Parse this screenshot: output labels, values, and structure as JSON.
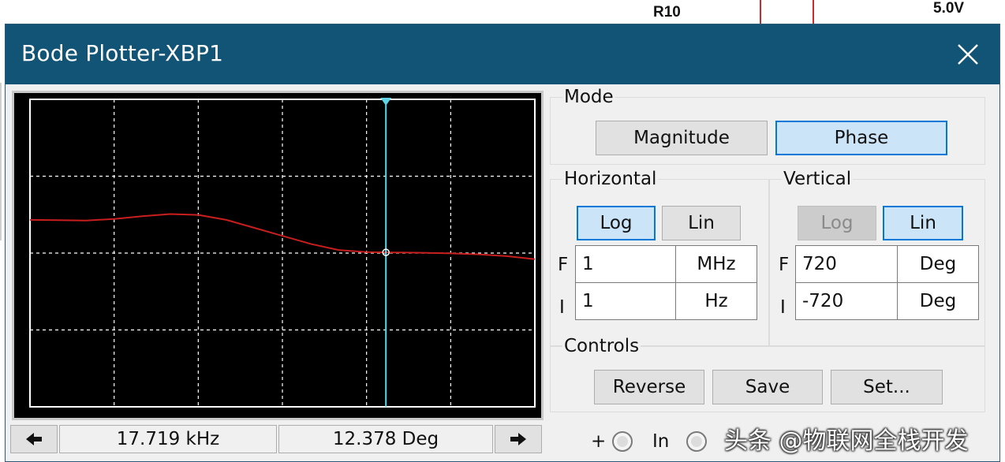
{
  "background": {
    "component_label": "R10",
    "voltage_label": "5.0V"
  },
  "window": {
    "title": "Bode Plotter-XBP1",
    "close_icon": "close-icon"
  },
  "plot": {
    "background": "#000000",
    "grid_color": "#ffffff",
    "trace_color": "#c81e1e",
    "cursor_color": "#5fd3e6",
    "grid_cols": 6,
    "grid_rows": 4,
    "cursor_position_fraction": 0.705,
    "trace_y_fractions": [
      0.392,
      0.393,
      0.394,
      0.389,
      0.38,
      0.373,
      0.376,
      0.392,
      0.418,
      0.444,
      0.47,
      0.49,
      0.497,
      0.498,
      0.499,
      0.501,
      0.504,
      0.51,
      0.52
    ]
  },
  "readout": {
    "left_arrow_icon": "arrow-left-icon",
    "right_arrow_icon": "arrow-right-icon",
    "frequency": "17.719 kHz",
    "value": "12.378 Deg"
  },
  "mode": {
    "label": "Mode",
    "magnitude": "Magnitude",
    "phase": "Phase",
    "selected": "Phase"
  },
  "horizontal": {
    "label": "Horizontal",
    "log": "Log",
    "lin": "Lin",
    "selected": "Log",
    "F_letter": "F",
    "I_letter": "I",
    "final_value": "1",
    "final_unit": "MHz",
    "initial_value": "1",
    "initial_unit": "Hz"
  },
  "vertical": {
    "label": "Vertical",
    "log": "Log",
    "lin": "Lin",
    "selected": "Lin",
    "F_letter": "F",
    "I_letter": "I",
    "final_value": "720",
    "final_unit": "Deg",
    "initial_value": "-720",
    "initial_unit": "Deg"
  },
  "controls": {
    "label": "Controls",
    "reverse": "Reverse",
    "save": "Save",
    "set": "Set..."
  },
  "terminals": {
    "plus": "+",
    "in": "In"
  },
  "watermark": "头条 @物联网全栈开发"
}
